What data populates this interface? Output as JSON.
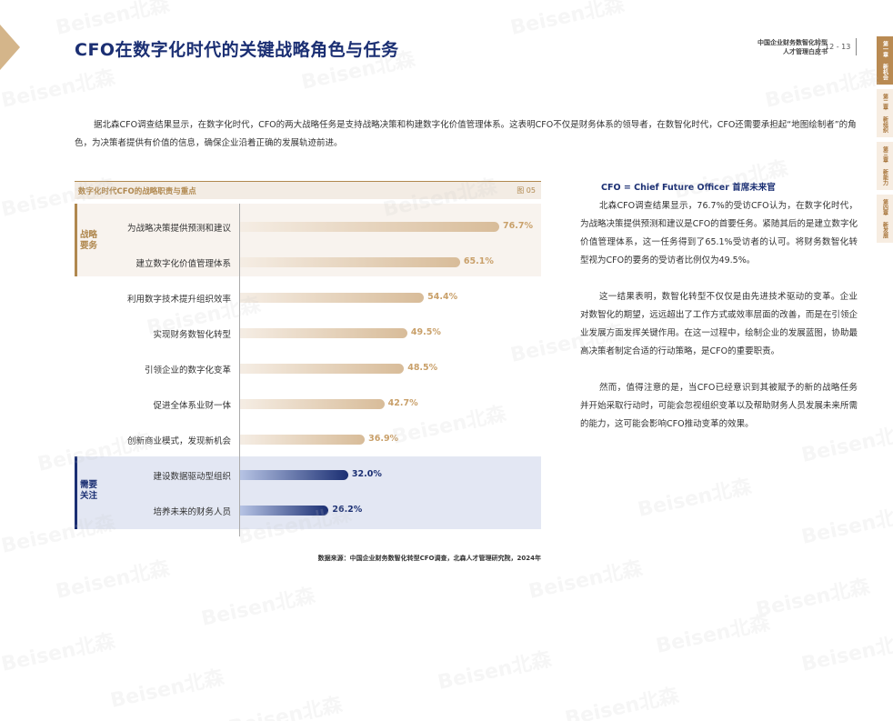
{
  "header": {
    "title": "CFO在数字化时代的关键战略角色与任务",
    "report_line1": "中国企业财务数智化转型",
    "report_line2": "人才管理白皮书",
    "page_numbers": "12 - 13"
  },
  "side_tabs": [
    {
      "label": "第一章 新机会",
      "active": true
    },
    {
      "label": "第二章 新组织",
      "active": false
    },
    {
      "label": "第三章 新能力",
      "active": false
    },
    {
      "label": "第四章 新发展",
      "active": false
    }
  ],
  "intro": "据北森CFO调查结果显示，在数字化时代，CFO的两大战略任务是支持战略决策和构建数字化价值管理体系。这表明CFO不仅是财务体系的领导者，在数智化时代，CFO还需要承担起“地图绘制者”的角色，为决策者提供有价值的信息，确保企业沿着正确的发展轨迹前进。",
  "chart_data": {
    "type": "bar",
    "title": "数字化时代CFO的战略职责与重点",
    "figure_label": "图 05",
    "groups": {
      "strategic": "战略要务",
      "attention": "需要关注"
    },
    "categories": [
      "为战略决策提供预测和建议",
      "建立数字化价值管理体系",
      "利用数字技术提升组织效率",
      "实现财务数智化转型",
      "引领企业的数字化变革",
      "促进全体系业财一体",
      "创新商业模式，发现新机会",
      "建设数据驱动型组织",
      "培养未来的财务人员"
    ],
    "values": [
      76.7,
      65.1,
      54.4,
      49.5,
      48.5,
      42.7,
      36.9,
      32.0,
      26.2
    ],
    "value_labels": [
      "76.7%",
      "65.1%",
      "54.4%",
      "49.5%",
      "48.5%",
      "42.7%",
      "36.9%",
      "32.0%",
      "26.2%"
    ],
    "colors": {
      "gold": "#d8bc99",
      "blue": "#1b2f73"
    },
    "source": "数据来源：中国企业财务数智化转型CFO调查，北森人才管理研究院，2024年"
  },
  "right": {
    "heading": "CFO = Chief Future Officer 首席未来官",
    "p1": "北森CFO调查结果显示，76.7%的受访CFO认为，在数字化时代，为战略决策提供预测和建议是CFO的首要任务。紧随其后的是建立数字化价值管理体系，这一任务得到了65.1%受访者的认可。将财务数智化转型视为CFO的要务的受访者比例仅为49.5%。",
    "p2": "这一结果表明，数智化转型不仅仅是由先进技术驱动的变革。企业对数智化的期望，远远超出了工作方式或效率层面的改善，而是在引领企业发展方面发挥关键作用。在这一过程中，绘制企业的发展蓝图，协助最高决策者制定合适的行动策略，是CFO的重要职责。",
    "p3": "然而，值得注意的是，当CFO已经意识到其被赋予的新的战略任务并开始采取行动时，可能会忽视组织变革以及帮助财务人员发展未来所需的能力，这可能会影响CFO推动变革的效果。"
  },
  "watermark_text": "Beisen北森",
  "colors": {
    "navy": "#1b2f73",
    "gold": "#b0884f"
  }
}
